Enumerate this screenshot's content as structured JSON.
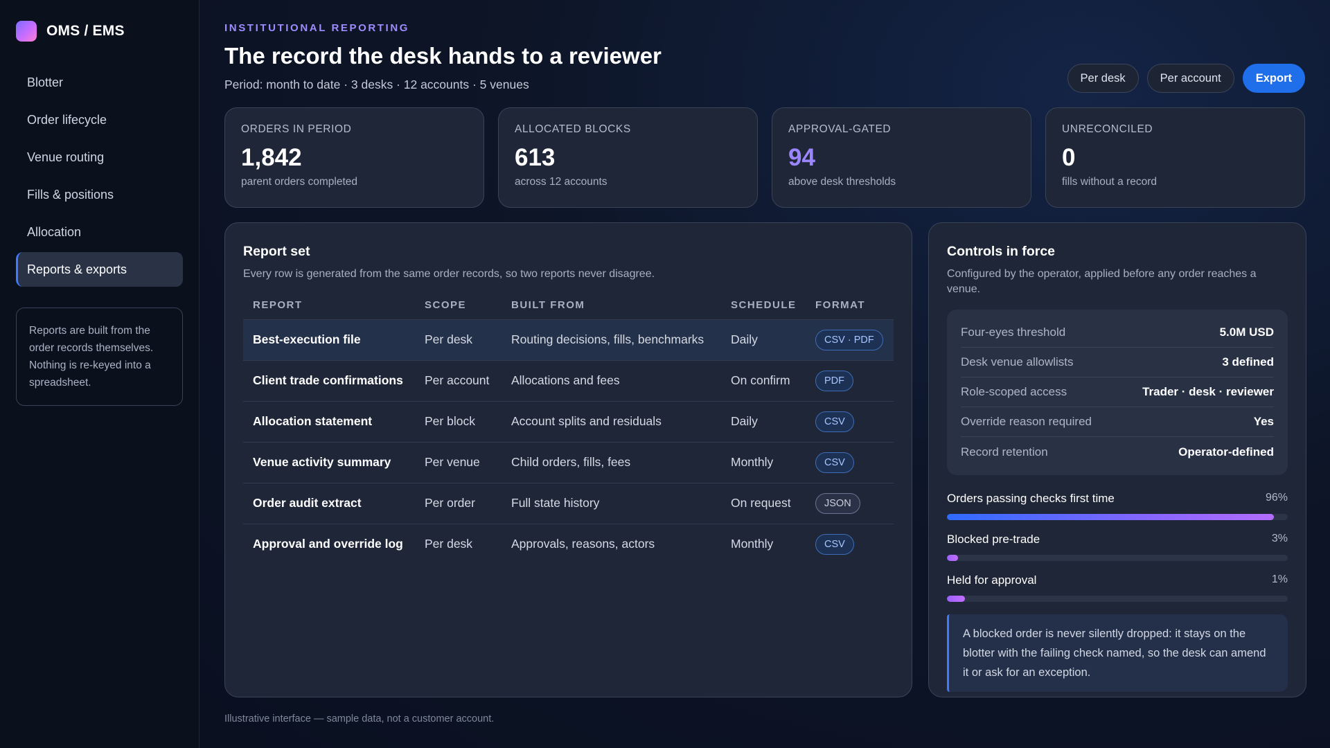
{
  "brand": {
    "name": "OMS / EMS"
  },
  "sidebar": {
    "items": [
      {
        "label": "Blotter"
      },
      {
        "label": "Order lifecycle"
      },
      {
        "label": "Venue routing"
      },
      {
        "label": "Fills & positions"
      },
      {
        "label": "Allocation"
      },
      {
        "label": "Reports & exports"
      }
    ],
    "note": "Reports are built from the order records themselves. Nothing is re-keyed into a spreadsheet."
  },
  "header": {
    "kicker": "INSTITUTIONAL REPORTING",
    "title": "The record the desk hands to a reviewer",
    "subtitle": "Period: month to date · 3 desks · 12 accounts · 5 venues"
  },
  "toolbar": {
    "per_desk": "Per desk",
    "per_account": "Per account",
    "export": "Export"
  },
  "stats": [
    {
      "label": "ORDERS IN PERIOD",
      "value": "1,842",
      "desc": "parent orders completed"
    },
    {
      "label": "ALLOCATED BLOCKS",
      "value": "613",
      "desc": "across 12 accounts"
    },
    {
      "label": "APPROVAL-GATED",
      "value": "94",
      "desc": "above desk thresholds"
    },
    {
      "label": "UNRECONCILED",
      "value": "0",
      "desc": "fills without a record"
    }
  ],
  "report_set": {
    "title": "Report set",
    "desc": "Every row is generated from the same order records, so two reports never disagree.",
    "columns": [
      "REPORT",
      "SCOPE",
      "BUILT FROM",
      "SCHEDULE",
      "FORMAT"
    ],
    "rows": [
      {
        "report": "Best-execution file",
        "scope": "Per desk",
        "built_from": "Routing decisions, fills, benchmarks",
        "schedule": "Daily",
        "format": "CSV · PDF"
      },
      {
        "report": "Client trade confirmations",
        "scope": "Per account",
        "built_from": "Allocations and fees",
        "schedule": "On confirm",
        "format": "PDF"
      },
      {
        "report": "Allocation statement",
        "scope": "Per block",
        "built_from": "Account splits and residuals",
        "schedule": "Daily",
        "format": "CSV"
      },
      {
        "report": "Venue activity summary",
        "scope": "Per venue",
        "built_from": "Child orders, fills, fees",
        "schedule": "Monthly",
        "format": "CSV"
      },
      {
        "report": "Order audit extract",
        "scope": "Per order",
        "built_from": "Full state history",
        "schedule": "On request",
        "format": "JSON"
      },
      {
        "report": "Approval and override log",
        "scope": "Per desk",
        "built_from": "Approvals, reasons, actors",
        "schedule": "Monthly",
        "format": "CSV"
      }
    ]
  },
  "controls": {
    "title": "Controls in force",
    "desc": "Configured by the operator, applied before any order reaches a venue.",
    "rows": [
      {
        "label": "Four-eyes threshold",
        "value": "5.0M USD"
      },
      {
        "label": "Desk venue allowlists",
        "value": "3 defined"
      },
      {
        "label": "Role-scoped access",
        "value": "Trader · desk · reviewer"
      },
      {
        "label": "Override reason required",
        "value": "Yes"
      },
      {
        "label": "Record retention",
        "value": "Operator-defined"
      }
    ],
    "metrics": [
      {
        "label": "Orders passing checks first time",
        "pct": "96%",
        "value": 96
      },
      {
        "label": "Blocked pre-trade",
        "pct": "3%",
        "value": 3
      },
      {
        "label": "Held for approval",
        "pct": "1%",
        "value": 1
      }
    ],
    "callout": "A blocked order is never silently dropped: it stays on the blotter with the failing check named, so the desk can amend it or ask for an exception."
  },
  "footnote": "Illustrative interface — sample data, not a customer account."
}
